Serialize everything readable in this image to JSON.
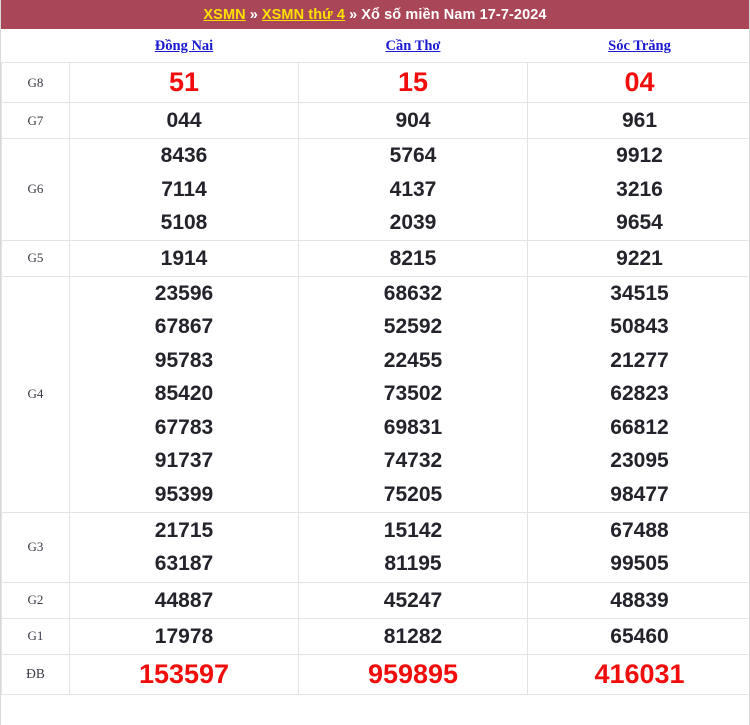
{
  "breadcrumb": {
    "link1": "XSMN",
    "sep1": "»",
    "link2": "XSMN thứ 4",
    "sep2": "»",
    "current": "Xổ số miền Nam 17-7-2024"
  },
  "colors": {
    "header_bg": "#a94658",
    "header_link": "#ffe100",
    "header_text": "#ffffff",
    "province_link": "#1a1ad0",
    "highlight_red": "#f20d0d",
    "number_text": "#23232b",
    "border": "#e3e3e3"
  },
  "table": {
    "provinces": [
      "Đồng Nai",
      "Cần Thơ",
      "Sóc Trăng"
    ],
    "rows": [
      {
        "label": "G8",
        "style": "red-large",
        "values": [
          [
            "51"
          ],
          [
            "15"
          ],
          [
            "04"
          ]
        ]
      },
      {
        "label": "G7",
        "style": "normal",
        "values": [
          [
            "044"
          ],
          [
            "904"
          ],
          [
            "961"
          ]
        ]
      },
      {
        "label": "G6",
        "style": "normal",
        "values": [
          [
            "8436",
            "7114",
            "5108"
          ],
          [
            "5764",
            "4137",
            "2039"
          ],
          [
            "9912",
            "3216",
            "9654"
          ]
        ]
      },
      {
        "label": "G5",
        "style": "normal",
        "values": [
          [
            "1914"
          ],
          [
            "8215"
          ],
          [
            "9221"
          ]
        ]
      },
      {
        "label": "G4",
        "style": "normal",
        "values": [
          [
            "23596",
            "67867",
            "95783",
            "85420",
            "67783",
            "91737",
            "95399"
          ],
          [
            "68632",
            "52592",
            "22455",
            "73502",
            "69831",
            "74732",
            "75205"
          ],
          [
            "34515",
            "50843",
            "21277",
            "62823",
            "66812",
            "23095",
            "98477"
          ]
        ]
      },
      {
        "label": "G3",
        "style": "normal",
        "values": [
          [
            "21715",
            "63187"
          ],
          [
            "15142",
            "81195"
          ],
          [
            "67488",
            "99505"
          ]
        ]
      },
      {
        "label": "G2",
        "style": "normal",
        "values": [
          [
            "44887"
          ],
          [
            "45247"
          ],
          [
            "48839"
          ]
        ]
      },
      {
        "label": "G1",
        "style": "normal",
        "values": [
          [
            "17978"
          ],
          [
            "81282"
          ],
          [
            "65460"
          ]
        ]
      },
      {
        "label": "ĐB",
        "style": "red-large",
        "values": [
          [
            "153597"
          ],
          [
            "959895"
          ],
          [
            "416031"
          ]
        ]
      }
    ]
  }
}
